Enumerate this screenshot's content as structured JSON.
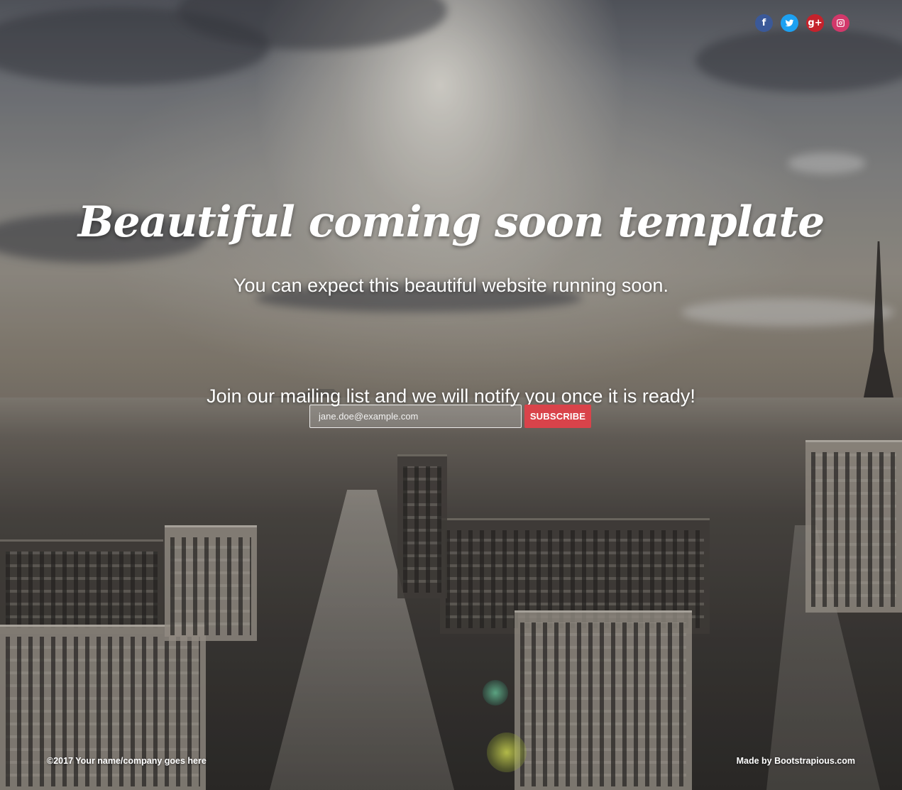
{
  "social": {
    "items": [
      {
        "network": "facebook",
        "icon": "facebook-icon",
        "glyph": "f",
        "color": "#3b5998"
      },
      {
        "network": "twitter",
        "icon": "twitter-icon",
        "glyph": "",
        "color": "#1da1f2"
      },
      {
        "network": "google-plus",
        "icon": "google-plus-icon",
        "glyph": "g+",
        "color": "#c4222c"
      },
      {
        "network": "instagram",
        "icon": "instagram-icon",
        "glyph": "",
        "color": "#d2386a"
      }
    ]
  },
  "hero": {
    "title": "Beautiful coming soon template",
    "subtitle": "You can expect this beautiful website running soon."
  },
  "mailing": {
    "text": "Join our mailing list and we will notify you once it is ready!",
    "email_placeholder": "jane.doe@example.com",
    "subscribe_label": "SUBSCRIBE",
    "button_color": "#d9434a"
  },
  "footer": {
    "copyright": "©2017 Your name/company goes here",
    "made_by_prefix": "Made by ",
    "made_by_link": "Bootstrapious.com"
  }
}
